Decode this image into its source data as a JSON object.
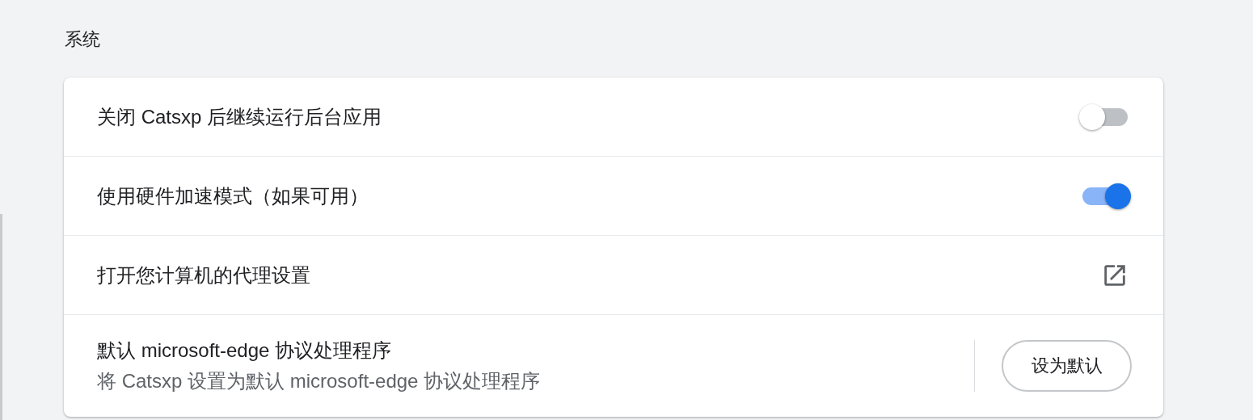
{
  "section": {
    "title": "系统"
  },
  "settings": [
    {
      "kind": "toggle",
      "label": "关闭 Catsxp 后继续运行后台应用",
      "on": false
    },
    {
      "kind": "toggle",
      "label": "使用硬件加速模式（如果可用）",
      "on": true
    },
    {
      "kind": "link",
      "label": "打开您计算机的代理设置"
    },
    {
      "kind": "button",
      "label": "默认 microsoft-edge 协议处理程序",
      "sublabel": "将 Catsxp 设置为默认 microsoft-edge 协议处理程序",
      "button": "设为默认"
    }
  ]
}
